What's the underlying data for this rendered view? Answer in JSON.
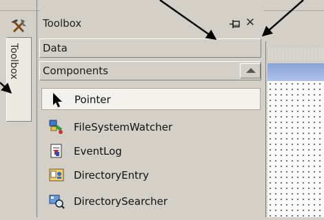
{
  "toolbox_tab": {
    "label": "Toolbox"
  },
  "panel": {
    "title": "Toolbox",
    "pin_glyph": "⊣",
    "close_glyph": "✕",
    "categories": [
      {
        "label": "Data"
      },
      {
        "label": "Components"
      }
    ],
    "items": [
      {
        "label": "Pointer",
        "icon": "pointer-arrow-icon",
        "selected": true
      },
      {
        "label": "FileSystemWatcher",
        "icon": "file-system-watcher-icon"
      },
      {
        "label": "EventLog",
        "icon": "event-log-icon"
      },
      {
        "label": "DirectoryEntry",
        "icon": "directory-entry-icon"
      },
      {
        "label": "DirectorySearcher",
        "icon": "directory-searcher-icon"
      }
    ]
  },
  "colors": {
    "panel_bg": "#d4d0c8",
    "selected_bg": "#f4f2ec",
    "designer_blue": "#8aa4d8"
  }
}
